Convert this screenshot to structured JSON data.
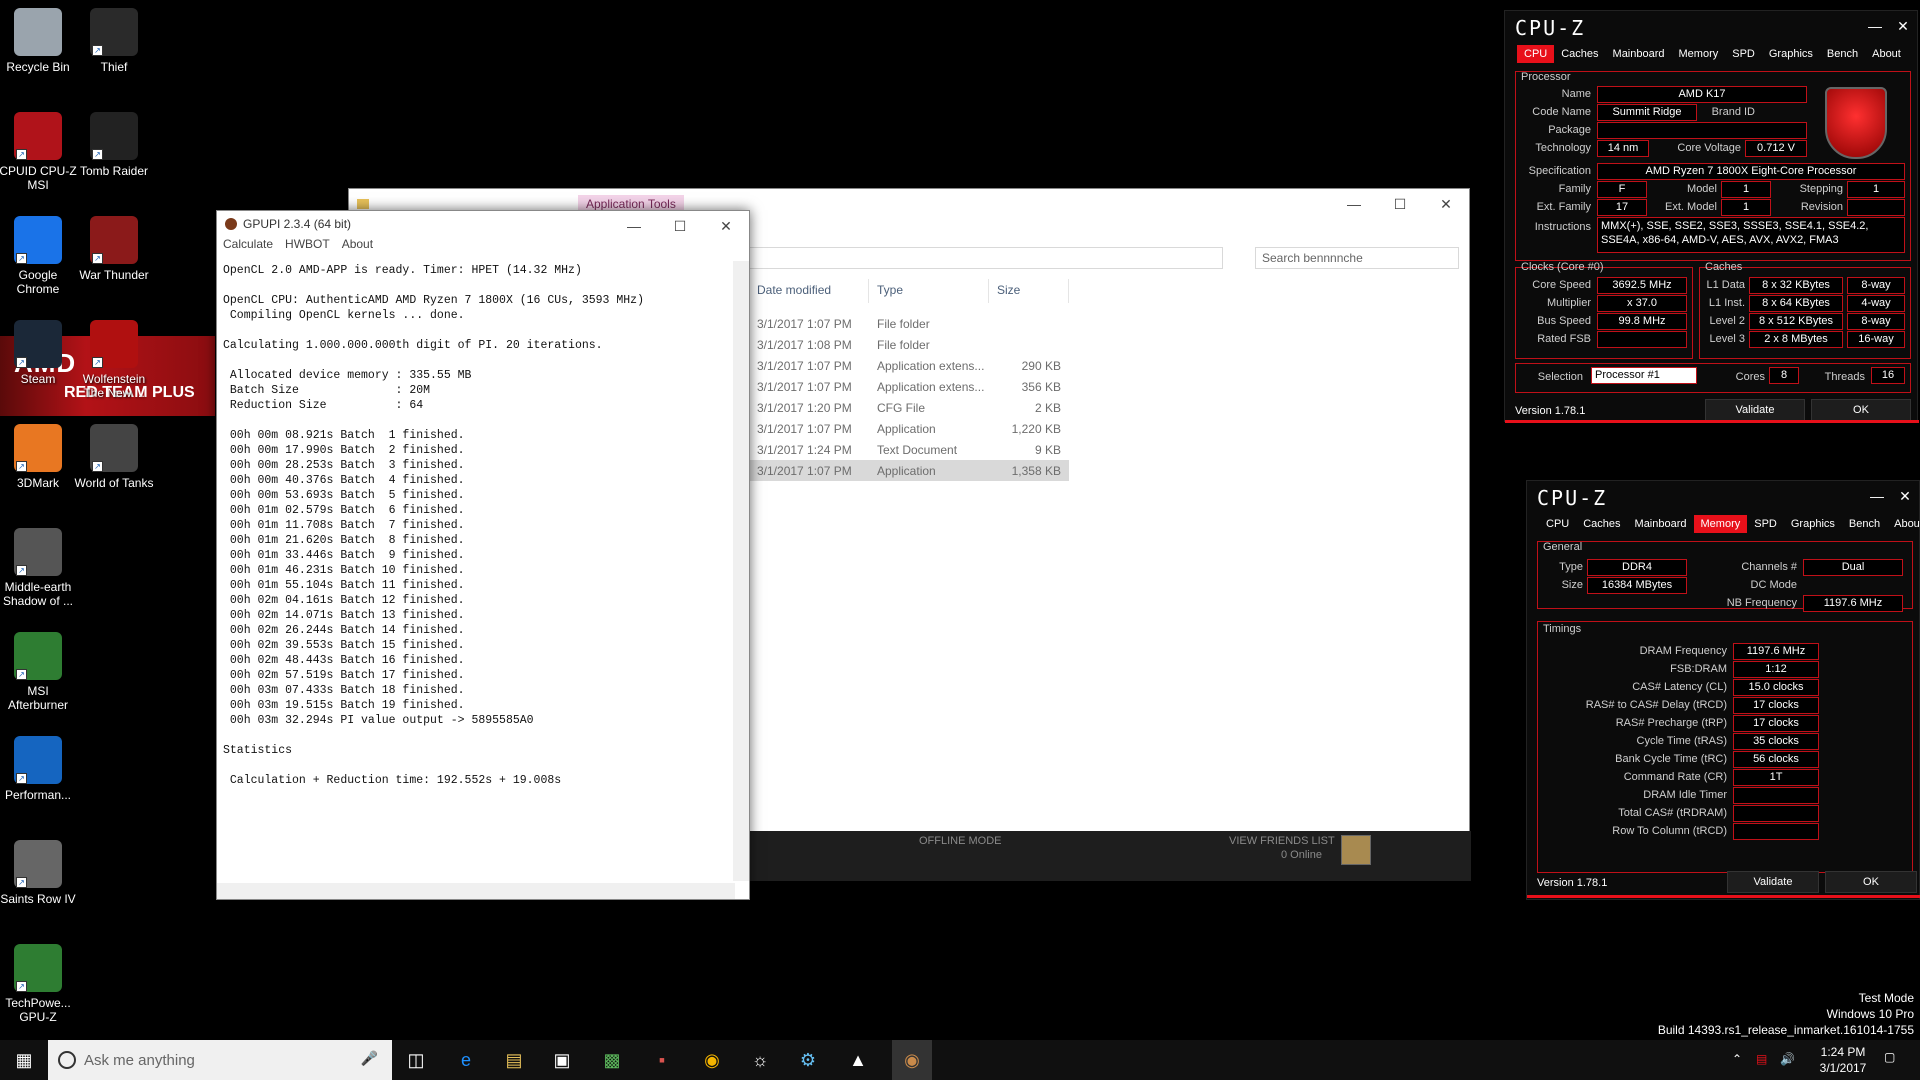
{
  "wallpaper": {
    "line1": "AMD",
    "line2": "RED TEAM PLUS"
  },
  "desktop_icons": [
    {
      "label": "Recycle Bin",
      "icon": "recycle-bin-icon",
      "color": "#9aa4ad"
    },
    {
      "label": "Thief",
      "icon": "thief-icon",
      "color": "#2a2a2a"
    },
    {
      "label": "CPUID CPU-Z MSI",
      "icon": "cpuz-icon",
      "color": "#b0131a"
    },
    {
      "label": "Tomb Raider",
      "icon": "tomb-raider-icon",
      "color": "#222"
    },
    {
      "label": "Google Chrome",
      "icon": "chrome-icon",
      "color": "#1a73e8"
    },
    {
      "label": "War Thunder",
      "icon": "war-thunder-icon",
      "color": "#8b1a1a"
    },
    {
      "label": "Steam",
      "icon": "steam-icon",
      "color": "#1b2838"
    },
    {
      "label": "Wolfenstein The New ...",
      "icon": "wolfenstein-icon",
      "color": "#b01010"
    },
    {
      "label": "3DMark",
      "icon": "3dmark-icon",
      "color": "#e87722"
    },
    {
      "label": "World of Tanks",
      "icon": "world-of-tanks-icon",
      "color": "#444"
    },
    {
      "label": "Middle-earth Shadow of ...",
      "icon": "middle-earth-icon",
      "color": "#555"
    },
    {
      "label": "MSI Afterburner",
      "icon": "afterburner-icon",
      "color": "#2e7d32"
    },
    {
      "label": "Performan...",
      "icon": "performance-icon",
      "color": "#1565c0"
    },
    {
      "label": "Saints Row IV",
      "icon": "saints-row-icon",
      "color": "#666"
    },
    {
      "label": "TechPowe... GPU-Z",
      "icon": "gpuz-icon",
      "color": "#2e7d32"
    }
  ],
  "explorer": {
    "title": "bennnnche",
    "ribbon_tab": "Application Tools",
    "search_placeholder": "Search bennnnche",
    "columns": [
      "Date modified",
      "Type",
      "Size"
    ],
    "rows": [
      {
        "date": "3/1/2017 1:07 PM",
        "type": "File folder",
        "size": ""
      },
      {
        "date": "3/1/2017 1:08 PM",
        "type": "File folder",
        "size": ""
      },
      {
        "date": "3/1/2017 1:07 PM",
        "type": "Application extens...",
        "size": "290 KB"
      },
      {
        "date": "3/1/2017 1:07 PM",
        "type": "Application extens...",
        "size": "356 KB"
      },
      {
        "date": "3/1/2017 1:20 PM",
        "type": "CFG File",
        "size": "2 KB"
      },
      {
        "date": "3/1/2017 1:07 PM",
        "type": "Application",
        "size": "1,220 KB"
      },
      {
        "date": "3/1/2017 1:24 PM",
        "type": "Text Document",
        "size": "9 KB"
      },
      {
        "date": "3/1/2017 1:07 PM",
        "type": "Application",
        "size": "1,358 KB"
      }
    ],
    "steam_offline": "OFFLINE MODE",
    "steam_friends": "VIEW FRIENDS LIST",
    "steam_online": "0 Online"
  },
  "gpupi": {
    "title": "GPUPI 2.3.4 (64 bit)",
    "menu": [
      "Calculate",
      "HWBOT",
      "About"
    ],
    "console": [
      "OpenCL 2.0 AMD-APP is ready. Timer: HPET (14.32 MHz)",
      "",
      "OpenCL CPU: AuthenticAMD AMD Ryzen 7 1800X (16 CUs, 3593 MHz)",
      " Compiling OpenCL kernels ... done.",
      "",
      "Calculating 1.000.000.000th digit of PI. 20 iterations.",
      "",
      " Allocated device memory : 335.55 MB",
      " Batch Size              : 20M",
      " Reduction Size          : 64",
      "",
      " 00h 00m 08.921s Batch  1 finished.",
      " 00h 00m 17.990s Batch  2 finished.",
      " 00h 00m 28.253s Batch  3 finished.",
      " 00h 00m 40.376s Batch  4 finished.",
      " 00h 00m 53.693s Batch  5 finished.",
      " 00h 01m 02.579s Batch  6 finished.",
      " 00h 01m 11.708s Batch  7 finished.",
      " 00h 01m 21.620s Batch  8 finished.",
      " 00h 01m 33.446s Batch  9 finished.",
      " 00h 01m 46.231s Batch 10 finished.",
      " 00h 01m 55.104s Batch 11 finished.",
      " 00h 02m 04.161s Batch 12 finished.",
      " 00h 02m 14.071s Batch 13 finished.",
      " 00h 02m 26.244s Batch 14 finished.",
      " 00h 02m 39.553s Batch 15 finished.",
      " 00h 02m 48.443s Batch 16 finished.",
      " 00h 02m 57.519s Batch 17 finished.",
      " 00h 03m 07.433s Batch 18 finished.",
      " 00h 03m 19.515s Batch 19 finished.",
      " 00h 03m 32.294s PI value output -> 5895585A0",
      "",
      "Statistics",
      "",
      " Calculation + Reduction time: 192.552s + 19.008s"
    ]
  },
  "cpuz1": {
    "title": "CPU-Z",
    "tabs": [
      "CPU",
      "Caches",
      "Mainboard",
      "Memory",
      "SPD",
      "Graphics",
      "Bench",
      "About"
    ],
    "active_tab": "CPU",
    "processor_label": "Processor",
    "name_label": "Name",
    "name": "AMD K17",
    "codename_label": "Code Name",
    "codename": "Summit Ridge",
    "brand_label": "Brand ID",
    "package_label": "Package",
    "technology_label": "Technology",
    "technology": "14 nm",
    "voltage_label": "Core Voltage",
    "voltage": "0.712 V",
    "spec_label": "Specification",
    "spec": "AMD Ryzen 7 1800X Eight-Core Processor",
    "family_label": "Family",
    "family": "F",
    "model_label": "Model",
    "model": "1",
    "stepping_label": "Stepping",
    "stepping": "1",
    "extfamily_label": "Ext. Family",
    "extfamily": "17",
    "extmodel_label": "Ext. Model",
    "extmodel": "1",
    "revision_label": "Revision",
    "instructions_label": "Instructions",
    "instructions": "MMX(+), SSE, SSE2, SSE3, SSSE3, SSE4.1, SSE4.2, SSE4A, x86-64, AMD-V, AES, AVX, AVX2, FMA3",
    "clocks_label": "Clocks (Core #0)",
    "corespeed_label": "Core Speed",
    "corespeed": "3692.5 MHz",
    "multiplier_label": "Multiplier",
    "multiplier": "x 37.0",
    "busspeed_label": "Bus Speed",
    "busspeed": "99.8 MHz",
    "ratedfsb_label": "Rated FSB",
    "caches_label": "Caches",
    "l1d_label": "L1 Data",
    "l1d": "8 x 32 KBytes",
    "l1d_way": "8-way",
    "l1i_label": "L1 Inst.",
    "l1i": "8 x 64 KBytes",
    "l1i_way": "4-way",
    "l2_label": "Level 2",
    "l2": "8 x 512 KBytes",
    "l2_way": "8-way",
    "l3_label": "Level 3",
    "l3": "2 x 8 MBytes",
    "l3_way": "16-way",
    "selection_label": "Selection",
    "selection": "Processor #1",
    "cores_label": "Cores",
    "cores": "8",
    "threads_label": "Threads",
    "threads": "16",
    "version": "Version 1.78.1",
    "validate": "Validate",
    "ok": "OK"
  },
  "cpuz2": {
    "title": "CPU-Z",
    "tabs": [
      "CPU",
      "Caches",
      "Mainboard",
      "Memory",
      "SPD",
      "Graphics",
      "Bench",
      "About"
    ],
    "active_tab": "Memory",
    "general_label": "General",
    "type_label": "Type",
    "type": "DDR4",
    "size_label": "Size",
    "size": "16384 MBytes",
    "channels_label": "Channels #",
    "channels": "Dual",
    "dcmode_label": "DC Mode",
    "nbfreq_label": "NB Frequency",
    "nbfreq": "1197.6 MHz",
    "timings_label": "Timings",
    "timings": [
      {
        "label": "DRAM Frequency",
        "value": "1197.6 MHz"
      },
      {
        "label": "FSB:DRAM",
        "value": "1:12"
      },
      {
        "label": "CAS# Latency (CL)",
        "value": "15.0 clocks"
      },
      {
        "label": "RAS# to CAS# Delay (tRCD)",
        "value": "17 clocks"
      },
      {
        "label": "RAS# Precharge (tRP)",
        "value": "17 clocks"
      },
      {
        "label": "Cycle Time (tRAS)",
        "value": "35 clocks"
      },
      {
        "label": "Bank Cycle Time (tRC)",
        "value": "56 clocks"
      },
      {
        "label": "Command Rate (CR)",
        "value": "1T"
      },
      {
        "label": "DRAM Idle Timer",
        "value": ""
      },
      {
        "label": "Total CAS# (tRDRAM)",
        "value": ""
      },
      {
        "label": "Row To Column (tRCD)",
        "value": ""
      }
    ],
    "version": "Version 1.78.1",
    "validate": "Validate",
    "ok": "OK"
  },
  "watermark": {
    "line1": "Test Mode",
    "line2": "Windows 10 Pro",
    "line3": "Build 14393.rs1_release_inmarket.161014-1755"
  },
  "taskbar": {
    "search_placeholder": "Ask me anything",
    "time": "1:24 PM",
    "date": "3/1/2017"
  }
}
